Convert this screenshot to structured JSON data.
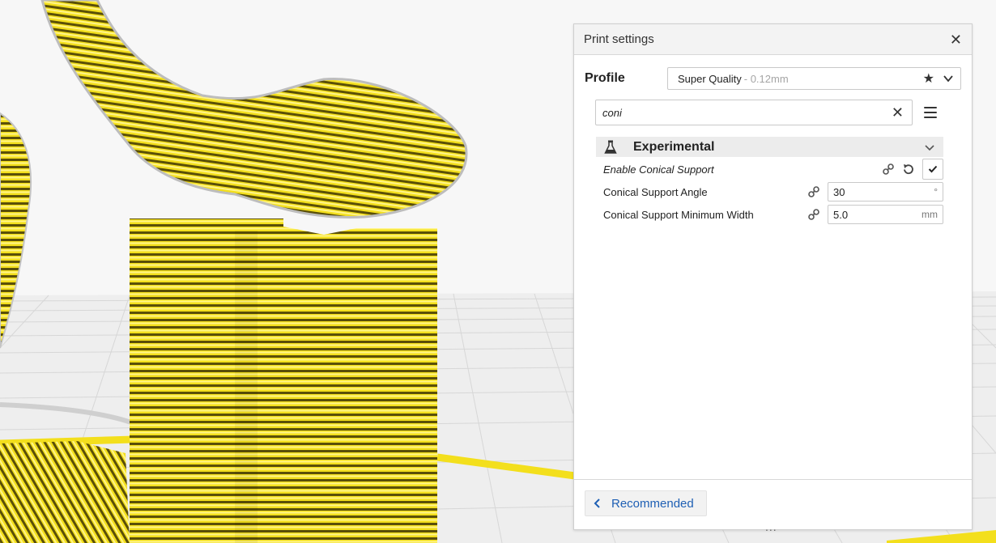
{
  "panel": {
    "title": "Print settings",
    "close_glyph": "✕"
  },
  "profile": {
    "label": "Profile",
    "name": "Super Quality",
    "layer_height": " - 0.12mm",
    "favorite_icon": "star-icon",
    "dropdown_icon": "chevron-down-icon"
  },
  "search": {
    "value": "coni",
    "clear_glyph": "✕",
    "menu_icon": "hamburger-menu-icon"
  },
  "category": {
    "label": "Experimental",
    "icon": "flask-icon"
  },
  "settings": [
    {
      "label": "Enable Conical Support",
      "type": "checkbox",
      "checked": true
    },
    {
      "label": "Conical Support Angle",
      "type": "number",
      "value": "30",
      "unit": "°"
    },
    {
      "label": "Conical Support Minimum Width",
      "type": "number",
      "value": "5.0",
      "unit": "mm"
    }
  ],
  "footer": {
    "recommended_label": "Recommended",
    "drag_handle": "..."
  },
  "colors": {
    "print_yellow": "#f6e21e",
    "link_blue": "#1e5fb4",
    "build_plate": "#f0f0f0"
  }
}
